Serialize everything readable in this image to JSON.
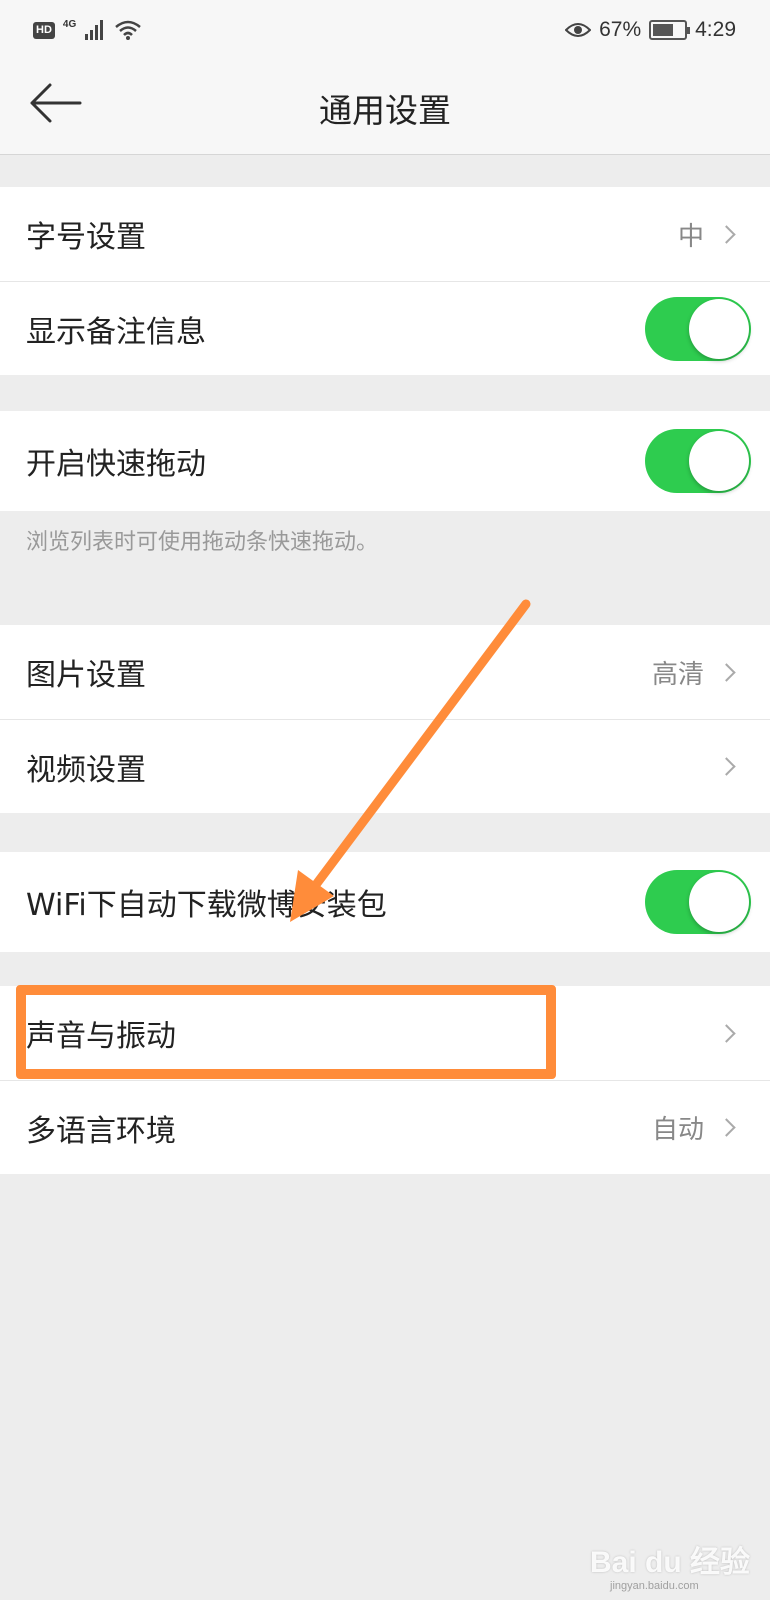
{
  "status_bar": {
    "hd": "HD",
    "network": "4G",
    "battery_percent": "67%",
    "battery_level": 0.67,
    "time": "4:29",
    "icons": [
      "signal-icon",
      "wifi-icon",
      "eye-icon",
      "battery-icon"
    ]
  },
  "header": {
    "title": "通用设置",
    "back_icon": "back-arrow-icon"
  },
  "groups": {
    "display": {
      "font_size": {
        "label": "字号设置",
        "value": "中"
      },
      "show_remark": {
        "label": "显示备注信息",
        "on": true
      }
    },
    "scroll": {
      "fast_drag": {
        "label": "开启快速拖动",
        "on": true
      },
      "hint": "浏览列表时可使用拖动条快速拖动。"
    },
    "media": {
      "image": {
        "label": "图片设置",
        "value": "高清"
      },
      "video": {
        "label": "视频设置"
      }
    },
    "download": {
      "wifi_auto": {
        "label": "WiFi下自动下载微博安装包",
        "on": true
      }
    },
    "misc": {
      "sound": {
        "label": "声音与振动"
      },
      "language": {
        "label": "多语言环境",
        "value": "自动"
      }
    }
  },
  "annotation": {
    "color": "#ff8c3a"
  },
  "colors": {
    "toggle_on": "#2ecc4f",
    "background": "#ededed"
  },
  "watermark": {
    "brand": "Bai du 经验",
    "url": "jingyan.baidu.com"
  }
}
